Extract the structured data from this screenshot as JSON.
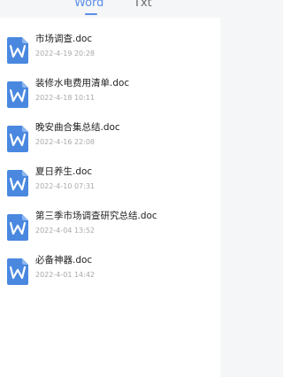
{
  "tabs": [
    {
      "label": "Word",
      "active": true
    },
    {
      "label": "Txt",
      "active": false
    }
  ],
  "colors": {
    "accent": "#5b8fe8",
    "icon_blue": "#4a88e0",
    "title_text": "#222222",
    "date_text": "#a9a9a9"
  },
  "files": [
    {
      "name": "市场调查.doc",
      "date": "2022-4-19 20:28",
      "icon": "word-doc-icon"
    },
    {
      "name": "装修水电费用清单.doc",
      "date": "2022-4-18 10:11",
      "icon": "word-doc-icon"
    },
    {
      "name": "晚安曲合集总结.doc",
      "date": "2022-4-16 22:08",
      "icon": "word-doc-icon"
    },
    {
      "name": "夏日养生.doc",
      "date": "2022-4-10 07:31",
      "icon": "word-doc-icon"
    },
    {
      "name": "第三季市场调查研究总结.doc",
      "date": "2022-4-04 13:52",
      "icon": "word-doc-icon"
    },
    {
      "name": "必备神器.doc",
      "date": "2022-4-01 14:42",
      "icon": "word-doc-icon"
    }
  ]
}
